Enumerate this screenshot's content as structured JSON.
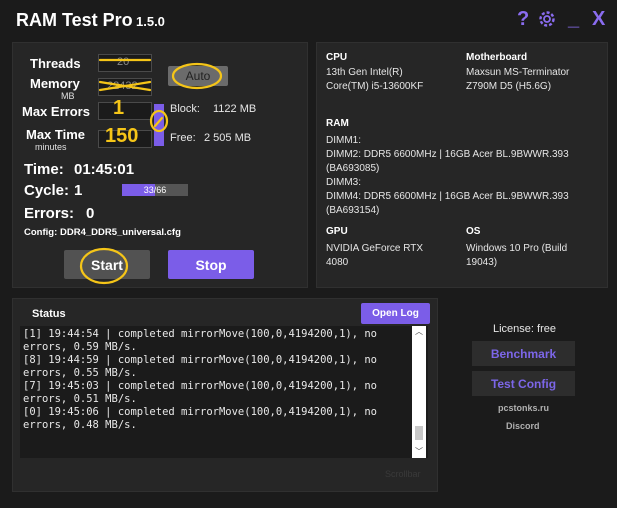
{
  "app": {
    "title": "RAM Test Pro",
    "version": "1.5.0"
  },
  "titlebar": {
    "help": "?",
    "minimize": "_",
    "close": "X"
  },
  "settings": {
    "threads_label": "Threads",
    "threads_value": "20",
    "memory_label": "Memory",
    "memory_unit": "MB",
    "memory_value": "22432",
    "auto_button": "Auto",
    "max_errors_label": "Max Errors",
    "max_errors_value": "1",
    "max_time_label": "Max Time",
    "max_time_unit": "minutes",
    "max_time_value": "150",
    "block_label": "Block:",
    "block_value": "1122 MB",
    "free_label": "Free:",
    "free_value": "2 505 MB"
  },
  "stats": {
    "time_label": "Time:",
    "time_value": "01:45:01",
    "cycle_label": "Cycle:",
    "cycle_value": "1",
    "cycle_progress_text": "33/66",
    "cycle_progress_fraction": 0.5,
    "errors_label": "Errors:",
    "errors_value": "0",
    "config_label": "Config:",
    "config_value": "DDR4_DDR5_universal.cfg"
  },
  "actions": {
    "start": "Start",
    "stop": "Stop"
  },
  "system": {
    "cpu_h": "CPU",
    "cpu": "13th Gen Intel(R)\nCore(TM) i5-13600KF",
    "mb_h": "Motherboard",
    "mb": "Maxsun MS-Terminator\nZ790M D5 (H5.6G)",
    "ram_h": "RAM",
    "ram": "DIMM1:\nDIMM2: DDR5 6600MHz | 16GB Acer BL.9BWWR.393\n(BA693085)\nDIMM3:\nDIMM4: DDR5 6600MHz | 16GB Acer BL.9BWWR.393\n(BA693154)",
    "gpu_h": "GPU",
    "gpu": "NVIDIA GeForce RTX\n4080",
    "os_h": "OS",
    "os": "Windows 10 Pro (Build\n19043)"
  },
  "status": {
    "tab": "Status",
    "open_log": "Open Log",
    "log": "[1] 19:44:54 | completed mirrorMove(100,0,4194200,1), no\nerrors, 0.59 MB/s.\n[8] 19:44:59 | completed mirrorMove(100,0,4194200,1), no\nerrors, 0.55 MB/s.\n[7] 19:45:03 | completed mirrorMove(100,0,4194200,1), no\nerrors, 0.51 MB/s.\n[0] 19:45:06 | completed mirrorMove(100,0,4194200,1), no\nerrors, 0.48 MB/s.",
    "scrollbar": "Scrollbar"
  },
  "side": {
    "license": "License: free",
    "benchmark": "Benchmark",
    "test_config": "Test Config",
    "site": "pcstonks.ru",
    "discord": "Discord"
  },
  "colors": {
    "accent": "#8a6cf0",
    "button_purple": "#7b5de8",
    "start_gray": "#525252",
    "annotation": "#f5c518"
  }
}
